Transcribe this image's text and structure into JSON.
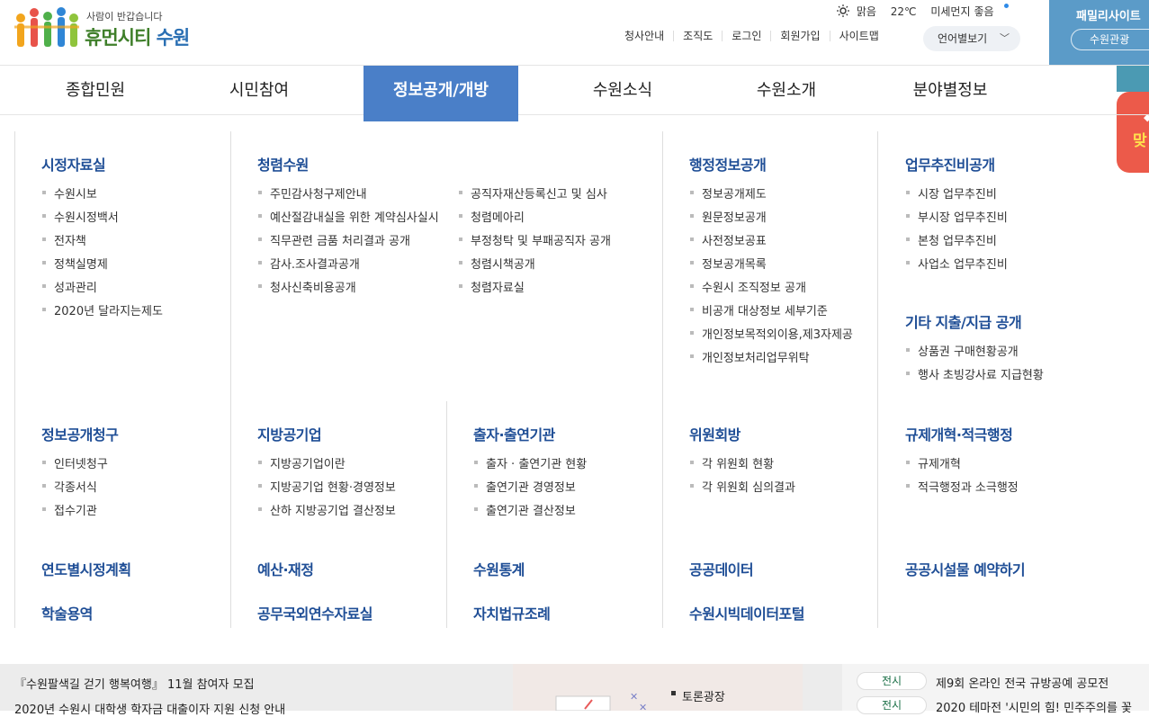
{
  "header": {
    "logo_tagline": "사람이 반갑습니다",
    "logo_name_part1": "휴먼시티",
    "logo_name_part2": "수원",
    "weather": {
      "condition": "맑음",
      "temperature": "22℃",
      "dust_label": "미세먼지",
      "dust_value": "좋음"
    },
    "util_links": [
      "청사안내",
      "조직도",
      "로그인",
      "회원가입",
      "사이트맵"
    ],
    "language_label": "언어별보기",
    "family_site_label": "패밀리사이트",
    "family_site_button": "수원관광",
    "side_banner_text": "맞"
  },
  "gnb": [
    "종합민원",
    "시민참여",
    "정보공개/개방",
    "수원소식",
    "수원소개",
    "분야별정보"
  ],
  "gnb_active_index": 2,
  "mega": {
    "col1_top": {
      "title": "시정자료실",
      "items": [
        "수원시보",
        "수원시정백서",
        "전자책",
        "정책실명제",
        "성과관리",
        "2020년 달라지는제도"
      ]
    },
    "col2_top": {
      "title": "청렴수원",
      "items_left": [
        "주민감사청구제안내",
        "예산절감내실을 위한 계약심사실시",
        "직무관련 금품 처리결과 공개",
        "감사.조사결과공개",
        "청사신축비용공개"
      ],
      "items_right": [
        "공직자재산등록신고 및 심사",
        "청렴메아리",
        "부정청탁 및 부패공직자 공개",
        "청렴시책공개",
        "청렴자료실"
      ]
    },
    "col4_top": {
      "title": "행정정보공개",
      "items": [
        "정보공개제도",
        "원문정보공개",
        "사전정보공표",
        "정보공개목록",
        "수원시 조직정보 공개",
        "비공개 대상정보 세부기준",
        "개인정보목적외이용,제3자제공",
        "개인정보처리업무위탁"
      ]
    },
    "col5_top": {
      "title": "업무추진비공개",
      "items": [
        "시장 업무추진비",
        "부시장 업무추진비",
        "본청 업무추진비",
        "사업소 업무추진비"
      ]
    },
    "col5_mid": {
      "title": "기타 지출/지급 공개",
      "items": [
        "상품권 구매현황공개",
        "행사 초빙강사료 지급현황"
      ]
    },
    "row2": [
      {
        "title": "정보공개청구",
        "items": [
          "인터넷청구",
          "각종서식",
          "접수기관"
        ]
      },
      {
        "title": "지방공기업",
        "items": [
          "지방공기업이란",
          "지방공기업 현황·경영정보",
          "산하 지방공기업 결산정보"
        ]
      },
      {
        "title": "출자·출연기관",
        "items": [
          "출자 · 출연기관 현황",
          "출연기관 경영정보",
          "출연기관 결산정보"
        ]
      },
      {
        "title": "위원회방",
        "items": [
          "각 위원회 현황",
          "각 위원회 심의결과"
        ]
      },
      {
        "title": "규제개혁·적극행정",
        "items": [
          "규제개혁",
          "적극행정과 소극행정"
        ]
      }
    ],
    "row3": [
      "연도별시정계획",
      "예산·재정",
      "수원통계",
      "공공데이터",
      "공공시설물 예약하기"
    ],
    "row4": [
      "학술용역",
      "공무국외연수자료실",
      "자치법규조례",
      "수원시빅데이터포털"
    ]
  },
  "bottom": {
    "notice1": "『수원팔색길 걷기 행복여행』 11월 참여자 모집",
    "notice2": "2020년 수원시 대학생 학자금 대출이자 지원 신청 안내",
    "mid_label": "토론광장",
    "right_items": [
      {
        "badge": "전시",
        "text": "제9회 온라인 전국 규방공예 공모전"
      },
      {
        "badge": "전시",
        "text": "2020 테마전 '시민의 힘! 민주주의를 꽃"
      }
    ]
  },
  "colors": {
    "accent": "#4a7fc8",
    "section_title": "#1f4e96",
    "logo_green": "#3f7f2a",
    "banner_red": "#ec5a4a"
  }
}
